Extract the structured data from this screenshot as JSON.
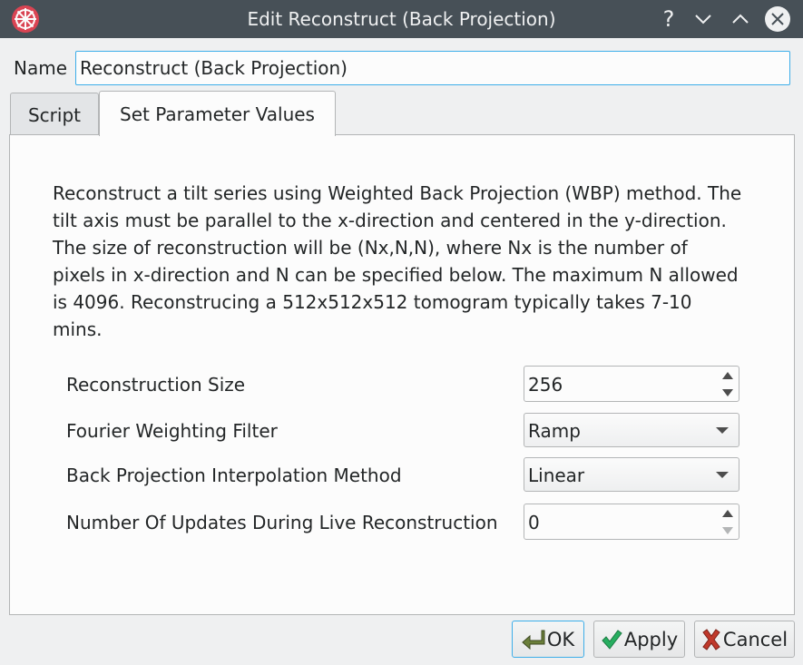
{
  "window": {
    "title": "Edit Reconstruct (Back Projection)",
    "help_glyph": "?"
  },
  "name_row": {
    "label": "Name",
    "value": "Reconstruct (Back Projection)"
  },
  "tabs": [
    {
      "label": "Script",
      "active": false
    },
    {
      "label": "Set Parameter Values",
      "active": true
    }
  ],
  "description": "Reconstruct a tilt series using Weighted Back Projection (WBP) method. The tilt axis must be parallel to the x-direction and centered in the y-direction. The size of reconstruction will be (Nx,N,N), where Nx is the number of pixels in x-direction and N can be specified below. The maximum N allowed is 4096. Reconstrucing a 512x512x512 tomogram typically takes 7-10 mins.",
  "parameters": [
    {
      "label": "Reconstruction Size",
      "type": "spinbox",
      "value": "256"
    },
    {
      "label": "Fourier Weighting Filter",
      "type": "combobox",
      "value": "Ramp"
    },
    {
      "label": "Back Projection Interpolation Method",
      "type": "combobox",
      "value": "Linear"
    },
    {
      "label": "Number Of Updates During Live Reconstruction",
      "type": "spinbox",
      "value": "0"
    }
  ],
  "buttons": {
    "ok": "OK",
    "apply": "Apply",
    "cancel": "Cancel"
  },
  "colors": {
    "titlebar": "#475057",
    "accent": "#3daee9",
    "app_icon": "#da4453",
    "apply_check": "#27ae60",
    "cancel_x": "#c0392b"
  }
}
